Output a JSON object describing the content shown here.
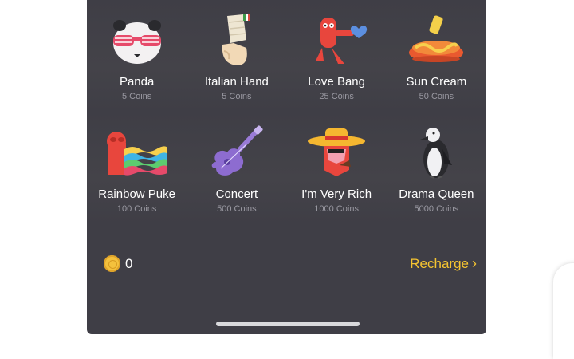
{
  "gifts": [
    {
      "name": "Panda",
      "price": "5 Coins",
      "icon": "panda-sunglasses-icon"
    },
    {
      "name": "Italian Hand",
      "price": "5 Coins",
      "icon": "italian-hand-icon"
    },
    {
      "name": "Love Bang",
      "price": "25 Coins",
      "icon": "love-bang-icon"
    },
    {
      "name": "Sun Cream",
      "price": "50 Coins",
      "icon": "sun-cream-icon"
    },
    {
      "name": "Rainbow Puke",
      "price": "100 Coins",
      "icon": "rainbow-puke-icon"
    },
    {
      "name": "Concert",
      "price": "500 Coins",
      "icon": "guitar-icon"
    },
    {
      "name": "I'm Very Rich",
      "price": "1000 Coins",
      "icon": "rich-hat-icon"
    },
    {
      "name": "Drama Queen",
      "price": "5000 Coins",
      "icon": "penguin-icon"
    }
  ],
  "wallet": {
    "balance": "0",
    "icon": "coin-icon"
  },
  "recharge": {
    "label": "Recharge",
    "icon": "chevron-right-icon"
  },
  "colors": {
    "panel": "#3f3e46",
    "accent": "#f5c431",
    "price": "#9a99a2"
  }
}
